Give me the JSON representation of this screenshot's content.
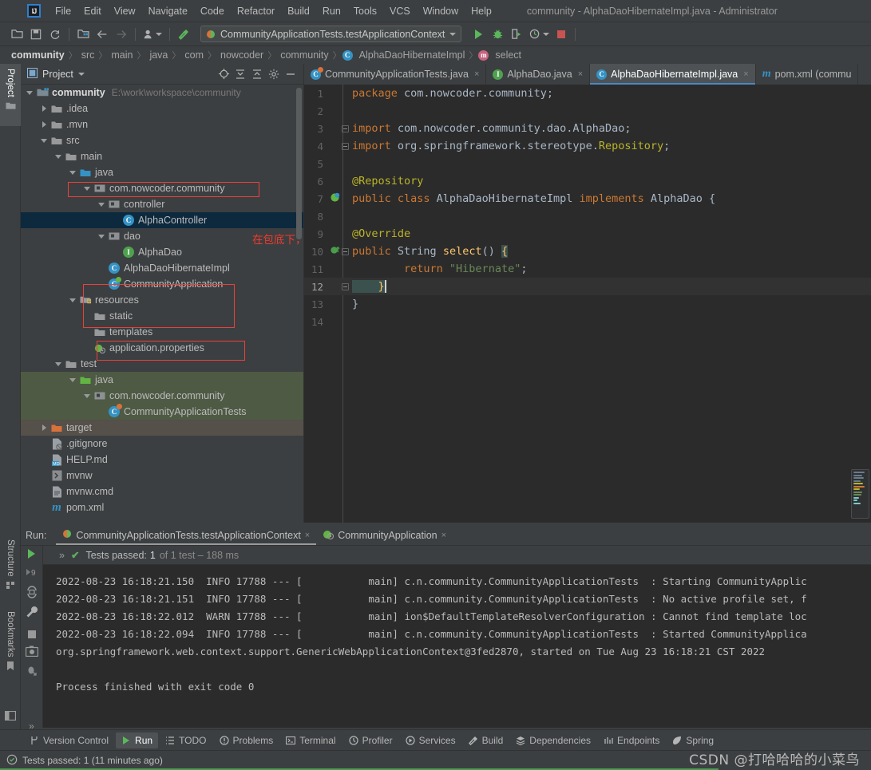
{
  "window": {
    "title": "community - AlphaDaoHibernateImpl.java - Administrator",
    "logo": "IJ"
  },
  "menu": {
    "items": [
      "File",
      "Edit",
      "View",
      "Navigate",
      "Code",
      "Refactor",
      "Build",
      "Run",
      "Tools",
      "VCS",
      "Window",
      "Help"
    ]
  },
  "toolbar": {
    "open_icon": "folder-open-icon",
    "save_icon": "save-icon",
    "sync_icon": "refresh-icon",
    "module_icon": "project-structure-icon",
    "back_icon": "arrow-left-icon",
    "forward_icon": "arrow-right-icon",
    "profile_icon": "user-profile-icon",
    "build_icon": "hammer-icon",
    "run_config": "CommunityApplicationTests.testApplicationContext",
    "run_icon": "run-icon",
    "debug_icon": "debug-icon",
    "coverage_icon": "run-with-coverage-icon",
    "profiler_icon": "profiler-icon",
    "stop_icon": "stop-icon"
  },
  "breadcrumb": {
    "items": [
      "community",
      "src",
      "main",
      "java",
      "com",
      "nowcoder",
      "community",
      "AlphaDaoHibernateImpl",
      "select"
    ],
    "separator": "〉"
  },
  "left_strip": {
    "project_tab": "Project",
    "structure_tab": "Structure",
    "bookmarks_tab": "Bookmarks"
  },
  "project_panel": {
    "title": "Project",
    "icons": [
      "locate-icon",
      "expand-all-icon",
      "collapse-all-icon",
      "settings-gear-icon",
      "hide-icon"
    ],
    "tree": [
      {
        "indent": 0,
        "arrow": "down",
        "icon": "module-folder",
        "label": "community",
        "path": "E:\\work\\workspace\\community",
        "bold": true
      },
      {
        "indent": 1,
        "arrow": "right",
        "icon": "folder-grey",
        "label": ".idea"
      },
      {
        "indent": 1,
        "arrow": "right",
        "icon": "folder-grey",
        "label": ".mvn"
      },
      {
        "indent": 1,
        "arrow": "down",
        "icon": "folder-grey",
        "label": "src"
      },
      {
        "indent": 2,
        "arrow": "down",
        "icon": "folder-grey",
        "label": "main"
      },
      {
        "indent": 3,
        "arrow": "down",
        "icon": "folder-blue",
        "label": "java"
      },
      {
        "indent": 4,
        "arrow": "down",
        "icon": "package",
        "label": "com.nowcoder.community"
      },
      {
        "indent": 5,
        "arrow": "down",
        "icon": "package",
        "label": "controller"
      },
      {
        "indent": 6,
        "arrow": "none",
        "icon": "class-c",
        "label": "AlphaController",
        "selected": true
      },
      {
        "indent": 5,
        "arrow": "down",
        "icon": "package",
        "label": "dao"
      },
      {
        "indent": 6,
        "arrow": "none",
        "icon": "interface-i",
        "label": "AlphaDao"
      },
      {
        "indent": 5,
        "arrow": "none",
        "icon": "class-c",
        "label": "AlphaDaoHibernateImpl"
      },
      {
        "indent": 5,
        "arrow": "none",
        "icon": "spring-class",
        "label": "CommunityApplication"
      },
      {
        "indent": 3,
        "arrow": "down",
        "icon": "folder-res",
        "label": "resources"
      },
      {
        "indent": 4,
        "arrow": "none",
        "icon": "folder-grey",
        "label": "static"
      },
      {
        "indent": 4,
        "arrow": "none",
        "icon": "folder-grey",
        "label": "templates"
      },
      {
        "indent": 4,
        "arrow": "none",
        "icon": "properties",
        "label": "application.properties"
      },
      {
        "indent": 2,
        "arrow": "down",
        "icon": "folder-grey",
        "label": "test"
      },
      {
        "indent": 3,
        "arrow": "down",
        "icon": "folder-green",
        "label": "java",
        "hl": "green"
      },
      {
        "indent": 4,
        "arrow": "down",
        "icon": "package",
        "label": "com.nowcoder.community",
        "hl": "green"
      },
      {
        "indent": 5,
        "arrow": "none",
        "icon": "test-class",
        "label": "CommunityApplicationTests",
        "hl": "green"
      },
      {
        "indent": 1,
        "arrow": "right",
        "icon": "folder-orange",
        "label": "target",
        "hl": "brown"
      },
      {
        "indent": 1,
        "arrow": "none",
        "icon": "gitignore",
        "label": ".gitignore"
      },
      {
        "indent": 1,
        "arrow": "none",
        "icon": "markdown",
        "label": "HELP.md"
      },
      {
        "indent": 1,
        "arrow": "none",
        "icon": "shell",
        "label": "mvnw"
      },
      {
        "indent": 1,
        "arrow": "none",
        "icon": "cmd",
        "label": "mvnw.cmd"
      },
      {
        "indent": 1,
        "arrow": "none",
        "icon": "maven",
        "label": "pom.xml"
      }
    ]
  },
  "annotations": {
    "note_text": "在包底下，且有注解",
    "color": "#f03a2e",
    "arrow": "red-arrow-icon",
    "boxes": [
      "com.nowcoder.community-box",
      "dao-alphadao-box",
      "communityapplication-box"
    ]
  },
  "editor": {
    "tabs": [
      {
        "label": "CommunityApplicationTests.java",
        "icon": "test-class",
        "active": false,
        "close": "×"
      },
      {
        "label": "AlphaDao.java",
        "icon": "interface-i",
        "active": false,
        "close": "×"
      },
      {
        "label": "AlphaDaoHibernateImpl.java",
        "icon": "class-c",
        "active": true,
        "close": "×"
      },
      {
        "label": "pom.xml (commu",
        "icon": "maven",
        "active": false,
        "close": ""
      }
    ],
    "lines": [
      {
        "n": "1",
        "segments": [
          [
            "k",
            "package "
          ],
          [
            "t",
            "com.nowcoder.community;"
          ]
        ]
      },
      {
        "n": "2",
        "segments": []
      },
      {
        "n": "3",
        "fold": true,
        "segments": [
          [
            "k",
            "import "
          ],
          [
            "t",
            "com.nowcoder.community.dao.AlphaDao;"
          ]
        ]
      },
      {
        "n": "4",
        "fold": true,
        "segments": [
          [
            "k",
            "import "
          ],
          [
            "t",
            "org.springframework.stereotype."
          ],
          [
            "a",
            "Repository"
          ],
          [
            "t",
            ";"
          ]
        ]
      },
      {
        "n": "5",
        "segments": []
      },
      {
        "n": "6",
        "segments": [
          [
            "a",
            "@Repository"
          ]
        ]
      },
      {
        "n": "7",
        "marker": "spring-bean-icon",
        "segments": [
          [
            "k",
            "public class "
          ],
          [
            "t",
            "AlphaDaoHibernateImpl "
          ],
          [
            "k",
            "implements "
          ],
          [
            "t",
            "AlphaDao "
          ],
          [
            "t",
            "{"
          ]
        ]
      },
      {
        "n": "8",
        "segments": []
      },
      {
        "n": "9",
        "segments": [
          [
            "a",
            "@Override"
          ]
        ]
      },
      {
        "n": "10",
        "marker": "implementing-method-icon",
        "fold": true,
        "segments": [
          [
            "k",
            "public "
          ],
          [
            "t",
            "String "
          ],
          [
            "f",
            "select"
          ],
          [
            "t",
            "() "
          ],
          [
            "brhl",
            "{"
          ]
        ]
      },
      {
        "n": "11",
        "segments": [
          [
            "k",
            "        return "
          ],
          [
            "s",
            "\"Hibernate\""
          ],
          [
            "t",
            ";"
          ]
        ]
      },
      {
        "n": "12",
        "current": true,
        "fold": true,
        "segments": [
          [
            "brhl",
            "    }"
          ]
        ]
      },
      {
        "n": "13",
        "segments": [
          [
            "t",
            "}"
          ]
        ]
      },
      {
        "n": "14",
        "segments": []
      }
    ]
  },
  "run_panel": {
    "run_label": "Run:",
    "tabs": [
      {
        "label": "CommunityApplicationTests.testApplicationContext",
        "icon": "test-run-icon",
        "active": true,
        "close": "×"
      },
      {
        "label": "CommunityApplication",
        "icon": "spring-run-icon",
        "active": false,
        "close": "×"
      }
    ],
    "status": {
      "rerun_icon": "rerun-icon",
      "expand_icon": "»",
      "check": "✔",
      "passed_label": "Tests passed:",
      "passed_count": "1",
      "detail": "of 1 test – 188 ms"
    },
    "gutter_icons": [
      "run-icon",
      "rerun-failed-icon",
      "rerun-automatically-icon",
      "settings-wrench-icon",
      "stop-icon",
      "screenshot-icon",
      "debug-icon",
      "expand-more-icon"
    ],
    "console": [
      "2022-08-23 16:18:21.150  INFO 17788 --- [           main] c.n.community.CommunityApplicationTests  : Starting CommunityApplic",
      "2022-08-23 16:18:21.151  INFO 17788 --- [           main] c.n.community.CommunityApplicationTests  : No active profile set, f",
      "2022-08-23 16:18:22.012  WARN 17788 --- [           main] ion$DefaultTemplateResolverConfiguration : Cannot find template loc",
      "2022-08-23 16:18:22.094  INFO 17788 --- [           main] c.n.community.CommunityApplicationTests  : Started CommunityApplica",
      "org.springframework.web.context.support.GenericWebApplicationContext@3fed2870, started on Tue Aug 23 16:18:21 CST 2022",
      "",
      "Process finished with exit code 0"
    ]
  },
  "bottom_bar": {
    "tabs": [
      {
        "label": "Version Control",
        "icon": "branch-icon",
        "active": false
      },
      {
        "label": "Run",
        "icon": "run-icon",
        "active": true
      },
      {
        "label": "TODO",
        "icon": "todo-list-icon",
        "active": false
      },
      {
        "label": "Problems",
        "icon": "problems-icon",
        "active": false
      },
      {
        "label": "Terminal",
        "icon": "terminal-icon",
        "active": false
      },
      {
        "label": "Profiler",
        "icon": "profiler-icon",
        "active": false
      },
      {
        "label": "Services",
        "icon": "services-icon",
        "active": false
      },
      {
        "label": "Build",
        "icon": "hammer-icon",
        "active": false
      },
      {
        "label": "Dependencies",
        "icon": "dependencies-icon",
        "active": false
      },
      {
        "label": "Endpoints",
        "icon": "endpoints-icon",
        "active": false
      },
      {
        "label": "Spring",
        "icon": "spring-leaf-icon",
        "active": false
      }
    ]
  },
  "status_bar": {
    "icon": "test-status-icon",
    "text": "Tests passed: 1 (11 minutes ago)",
    "watermark": "CSDN @打哈哈哈的小菜鸟"
  }
}
